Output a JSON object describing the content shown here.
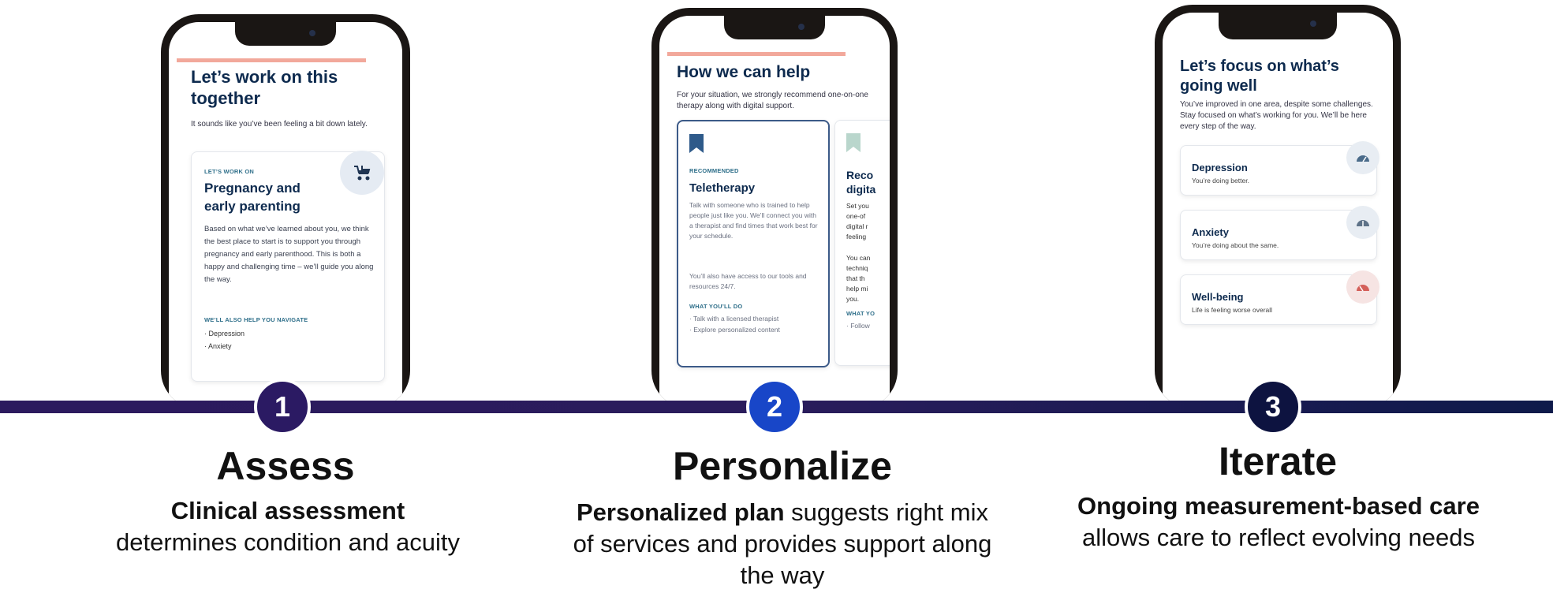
{
  "steps": [
    {
      "number": "1",
      "title": "Assess",
      "desc_bold": "Clinical assessment",
      "desc_rest": " determines condition and acuity",
      "color": "#2b1a63",
      "phone": {
        "title": "Let’s work on this together",
        "subtitle": "It sounds like you’ve been feeling a bit down lately.",
        "card": {
          "label": "LET’S WORK ON",
          "heading": "Pregnancy and early parenting",
          "icon": "stroller-icon",
          "body": "Based on what we’ve learned about you, we think the best place to start is to support you through pregnancy and early parenthood. This is both a happy and challenging time – we’ll guide you along the way.",
          "nav_label": "WE’LL ALSO HELP YOU NAVIGATE",
          "nav_items": [
            "· Depression",
            "· Anxiety"
          ]
        }
      }
    },
    {
      "number": "2",
      "title": "Personalize",
      "desc_bold": "Personalized plan",
      "desc_rest": " suggests right mix of services and provides support along the way",
      "color": "#1846c8",
      "phone": {
        "title": "How we can help",
        "subtitle": "For your situation, we strongly recommend one-on-one therapy along with digital support.",
        "card": {
          "icon": "bookmark-icon",
          "label": "RECOMMENDED",
          "heading": "Teletherapy",
          "body1": "Talk with someone who is trained to help people just like you. We’ll connect you with a therapist and find times that work best for your schedule.",
          "body2": "You’ll also have access to our tools and resources 24/7.",
          "what_label": "WHAT YOU’LL DO",
          "what_items": [
            "· Talk with a licensed therapist",
            "· Explore personalized content"
          ]
        },
        "card2": {
          "icon": "bookmark-icon",
          "heading": "Reco digita",
          "body1": "Set you one-of digital r feeling",
          "body2": "You can techniq that th help mi you.",
          "what_label": "WHAT YO",
          "what_items": [
            "· Follow"
          ]
        }
      }
    },
    {
      "number": "3",
      "title": "Iterate",
      "desc_bold": "Ongoing measurement-based care",
      "desc_rest": " allows care to reflect evolving needs",
      "color": "#0d1340",
      "phone": {
        "title": "Let’s focus on what’s going well",
        "subtitle": "You’ve improved in one area, despite some challenges. Stay focused on what’s working for you. We’ll be here every step of the way.",
        "items": [
          {
            "name": "Depression",
            "status": "You’re doing better.",
            "icon": "gauge-icon",
            "icon_color": "#4a6b8a",
            "badge_color": "#e8edf3"
          },
          {
            "name": "Anxiety",
            "status": "You’re doing about the same.",
            "icon": "gauge-icon",
            "icon_color": "#5e7288",
            "badge_color": "#e8edf3"
          },
          {
            "name": "Well-being",
            "status": "Life is feeling worse overall",
            "icon": "gauge-icon",
            "icon_color": "#d4605a",
            "badge_color": "#f6e4e3"
          }
        ]
      }
    }
  ]
}
